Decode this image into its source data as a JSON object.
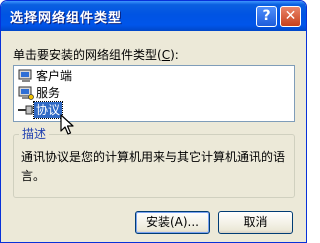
{
  "window": {
    "title": "选择网络组件类型",
    "help_icon": "question-mark-icon",
    "close_icon": "close-icon",
    "help_glyph": "?",
    "close_glyph": "✕"
  },
  "prompt": {
    "text": "单击要安装的网络组件类型",
    "shortcut_open": "(",
    "shortcut_key": "C",
    "shortcut_close": "):"
  },
  "components": [
    {
      "label": "客户端",
      "icon": "computer-client-icon",
      "selected": false
    },
    {
      "label": "服务",
      "icon": "service-icon",
      "selected": false
    },
    {
      "label": "协议",
      "icon": "protocol-icon",
      "selected": true
    }
  ],
  "description": {
    "legend": "描述",
    "text": "通讯协议是您的计算机用来与其它计算机通讯的语言。"
  },
  "buttons": {
    "ok_label": "安装(A)...",
    "cancel_label": "取消"
  },
  "colors": {
    "title_bar": "#0054e3",
    "selection": "#316ac5",
    "dialog_bg": "#ece9d8"
  }
}
